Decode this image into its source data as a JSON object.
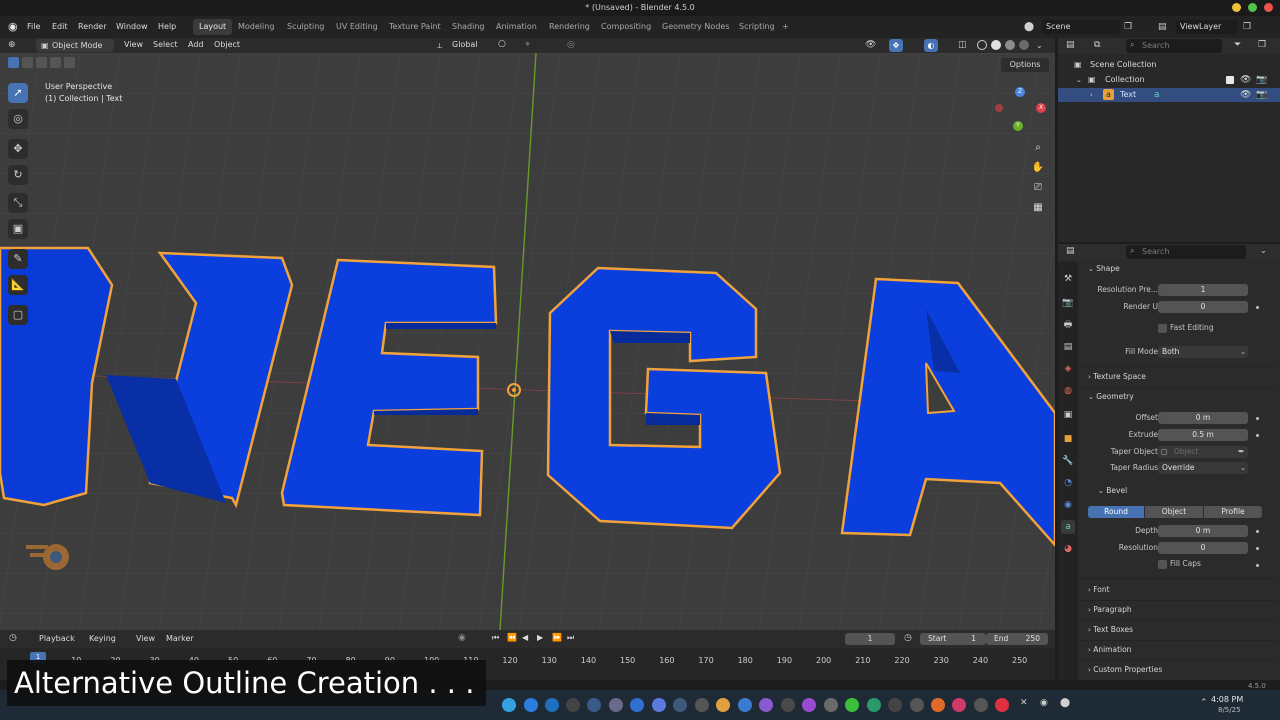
{
  "window": {
    "title": "* (Unsaved) - Blender 4.5.0"
  },
  "menubar": {
    "items": [
      "File",
      "Edit",
      "Render",
      "Window",
      "Help"
    ]
  },
  "workspaces": {
    "tabs": [
      "Layout",
      "Modeling",
      "Sculpting",
      "UV Editing",
      "Texture Paint",
      "Shading",
      "Animation",
      "Rendering",
      "Compositing",
      "Geometry Nodes",
      "Scripting"
    ],
    "active": "Layout",
    "add_label": "+"
  },
  "scene": {
    "name": "Scene",
    "view_layer": "ViewLayer"
  },
  "viewport_header": {
    "mode": "Object Mode",
    "menus": [
      "View",
      "Select",
      "Add",
      "Object"
    ],
    "orientation": "Global",
    "options": "Options"
  },
  "viewport": {
    "view_name": "User Perspective",
    "collection_info": "(1) Collection | Text",
    "text_object": "MEGA",
    "gizmo_labels": {
      "x": "X",
      "y": "Y",
      "z": "Z"
    }
  },
  "outliner": {
    "search_placeholder": "Search",
    "scene_collection": "Scene Collection",
    "collection": "Collection",
    "object": "Text"
  },
  "properties": {
    "search_placeholder": "Search",
    "shape": {
      "header": "Shape",
      "resolution_preview_label": "Resolution Pre...",
      "resolution_preview_value": "1",
      "render_u_label": "Render U",
      "render_u_value": "0",
      "fast_editing": "Fast Editing",
      "fill_mode_label": "Fill Mode",
      "fill_mode_value": "Both"
    },
    "texture_space": "Texture Space",
    "geometry": {
      "header": "Geometry",
      "offset_label": "Offset",
      "offset_value": "0 m",
      "extrude_label": "Extrude",
      "extrude_value": "0.5 m",
      "taper_object_label": "Taper Object",
      "taper_object_placeholder": "Object",
      "taper_radius_label": "Taper Radius",
      "taper_radius_value": "Override"
    },
    "bevel": {
      "header": "Bevel",
      "modes": [
        "Round",
        "Object",
        "Profile"
      ],
      "active_mode": "Round",
      "depth_label": "Depth",
      "depth_value": "0 m",
      "resolution_label": "Resolution",
      "resolution_value": "0",
      "fill_caps": "Fill Caps"
    },
    "collapsed_panels": [
      "Font",
      "Paragraph",
      "Text Boxes",
      "Animation",
      "Custom Properties"
    ]
  },
  "timeline": {
    "menus": [
      "Playback",
      "Keying",
      "View",
      "Marker"
    ],
    "current_frame": "1",
    "start_label": "Start",
    "start_value": "1",
    "end_label": "End",
    "end_value": "250",
    "ruler": [
      "1",
      "10",
      "20",
      "30",
      "40",
      "50",
      "60",
      "70",
      "80",
      "90",
      "100",
      "110",
      "120",
      "130",
      "140",
      "150",
      "160",
      "170",
      "180",
      "190",
      "200",
      "210",
      "220",
      "230",
      "240",
      "250"
    ]
  },
  "version": "4.5.0",
  "taskbar": {
    "time": "4:08 PM",
    "date": "8/5/25"
  },
  "overlay": {
    "caption": "Alternative Outline Creation . . ."
  },
  "colors": {
    "accent": "#4772b3",
    "text_blue": "#0a3bd6",
    "outline_orange": "#f2a23a",
    "viewport_bg": "#3e3e3e"
  }
}
